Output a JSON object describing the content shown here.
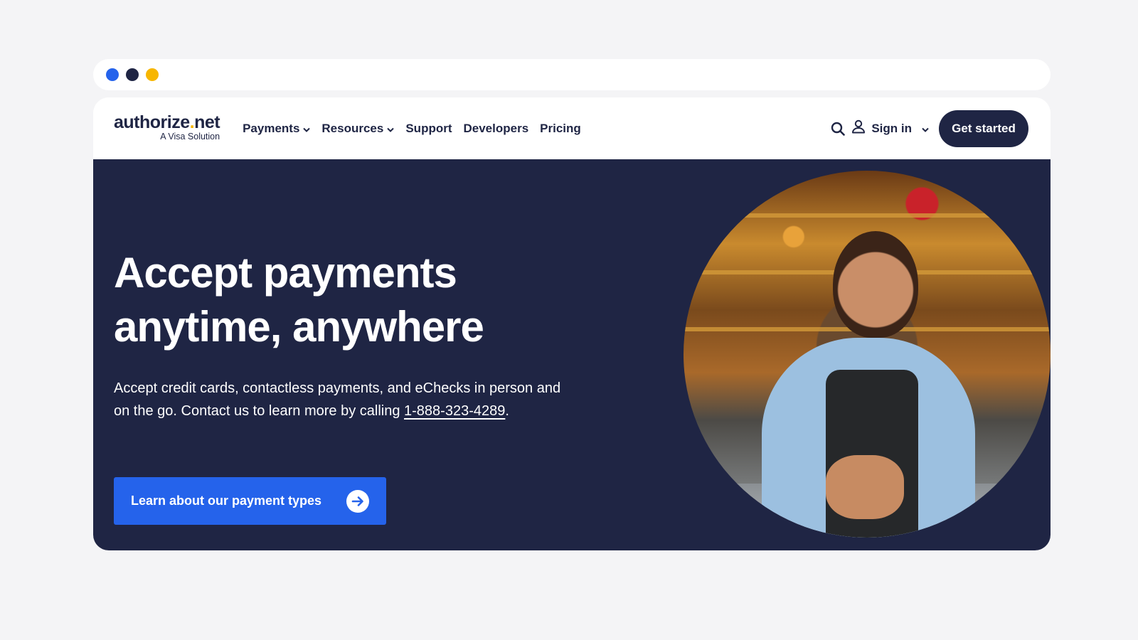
{
  "window": {
    "dots": [
      {
        "name": "blue-dot",
        "color": "#2563eb"
      },
      {
        "name": "navy-dot",
        "color": "#1f2544"
      },
      {
        "name": "yellow-dot",
        "color": "#f7b600"
      }
    ]
  },
  "nav": {
    "logo": {
      "word_main": "authorize",
      "word_dot": ".",
      "word_tld": "net",
      "sub": "A Visa Solution"
    },
    "items": [
      {
        "label": "Payments",
        "dropdown": true
      },
      {
        "label": "Resources",
        "dropdown": true
      },
      {
        "label": "Support",
        "dropdown": false
      },
      {
        "label": "Developers",
        "dropdown": false
      },
      {
        "label": "Pricing",
        "dropdown": false
      }
    ],
    "search_icon": "search-icon",
    "user_icon": "user-icon",
    "signin_label": "Sign in",
    "cta_label": "Get started"
  },
  "hero": {
    "title": "Accept payments anytime, anywhere",
    "body_text": "Accept credit cards, contactless payments, and eChecks in person and on the go. Contact us to learn more by calling ",
    "phone": "1-888-323-4289",
    "body_end": ".",
    "cta_label": "Learn about our payment types",
    "cta_icon": "arrow-right-icon",
    "image_alt": "Smiling woman in apron leaning on bar counter"
  },
  "colors": {
    "navy": "#1f2544",
    "blue": "#2563eb",
    "yellow": "#f7b600",
    "page_bg": "#f4f4f6"
  }
}
